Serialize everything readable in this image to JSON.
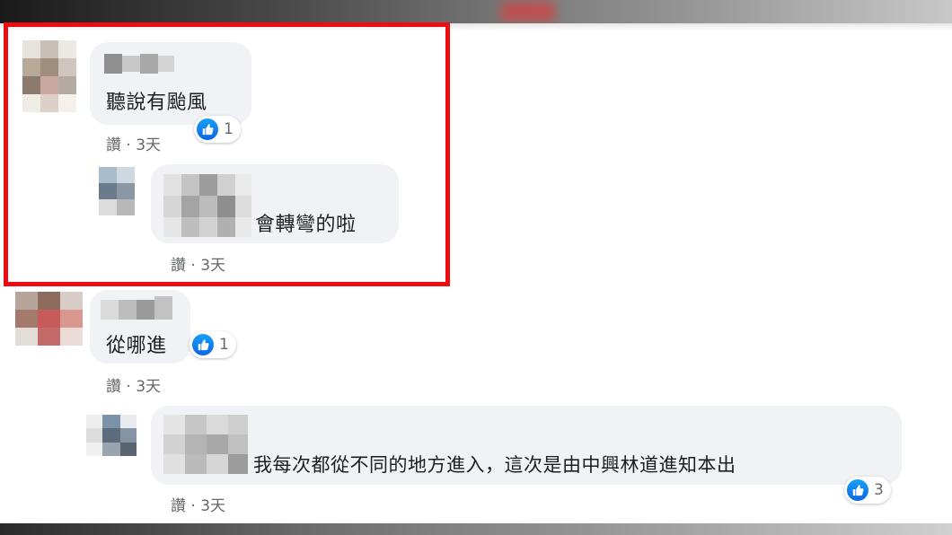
{
  "comments": [
    {
      "text": "聽說有颱風",
      "meta": "讚 · 3天",
      "like_count": "1",
      "reply": {
        "text": "會轉彎的啦",
        "meta": "讚 · 3天"
      }
    },
    {
      "text": "從哪進",
      "meta": "讚 · 3天",
      "like_count": "1",
      "reply": {
        "text": "我每次都從不同的地方進入，這次是由中興林道進知本出",
        "meta": "讚 · 3天",
        "like_count": "3"
      }
    }
  ],
  "colors": {
    "highlight_border": "#ee0c12",
    "bubble_bg": "#f0f2f5",
    "like_blue": "#1877f2",
    "meta_gray": "#65676b"
  },
  "icons": {
    "reaction": "like-thumbs-up-icon"
  }
}
